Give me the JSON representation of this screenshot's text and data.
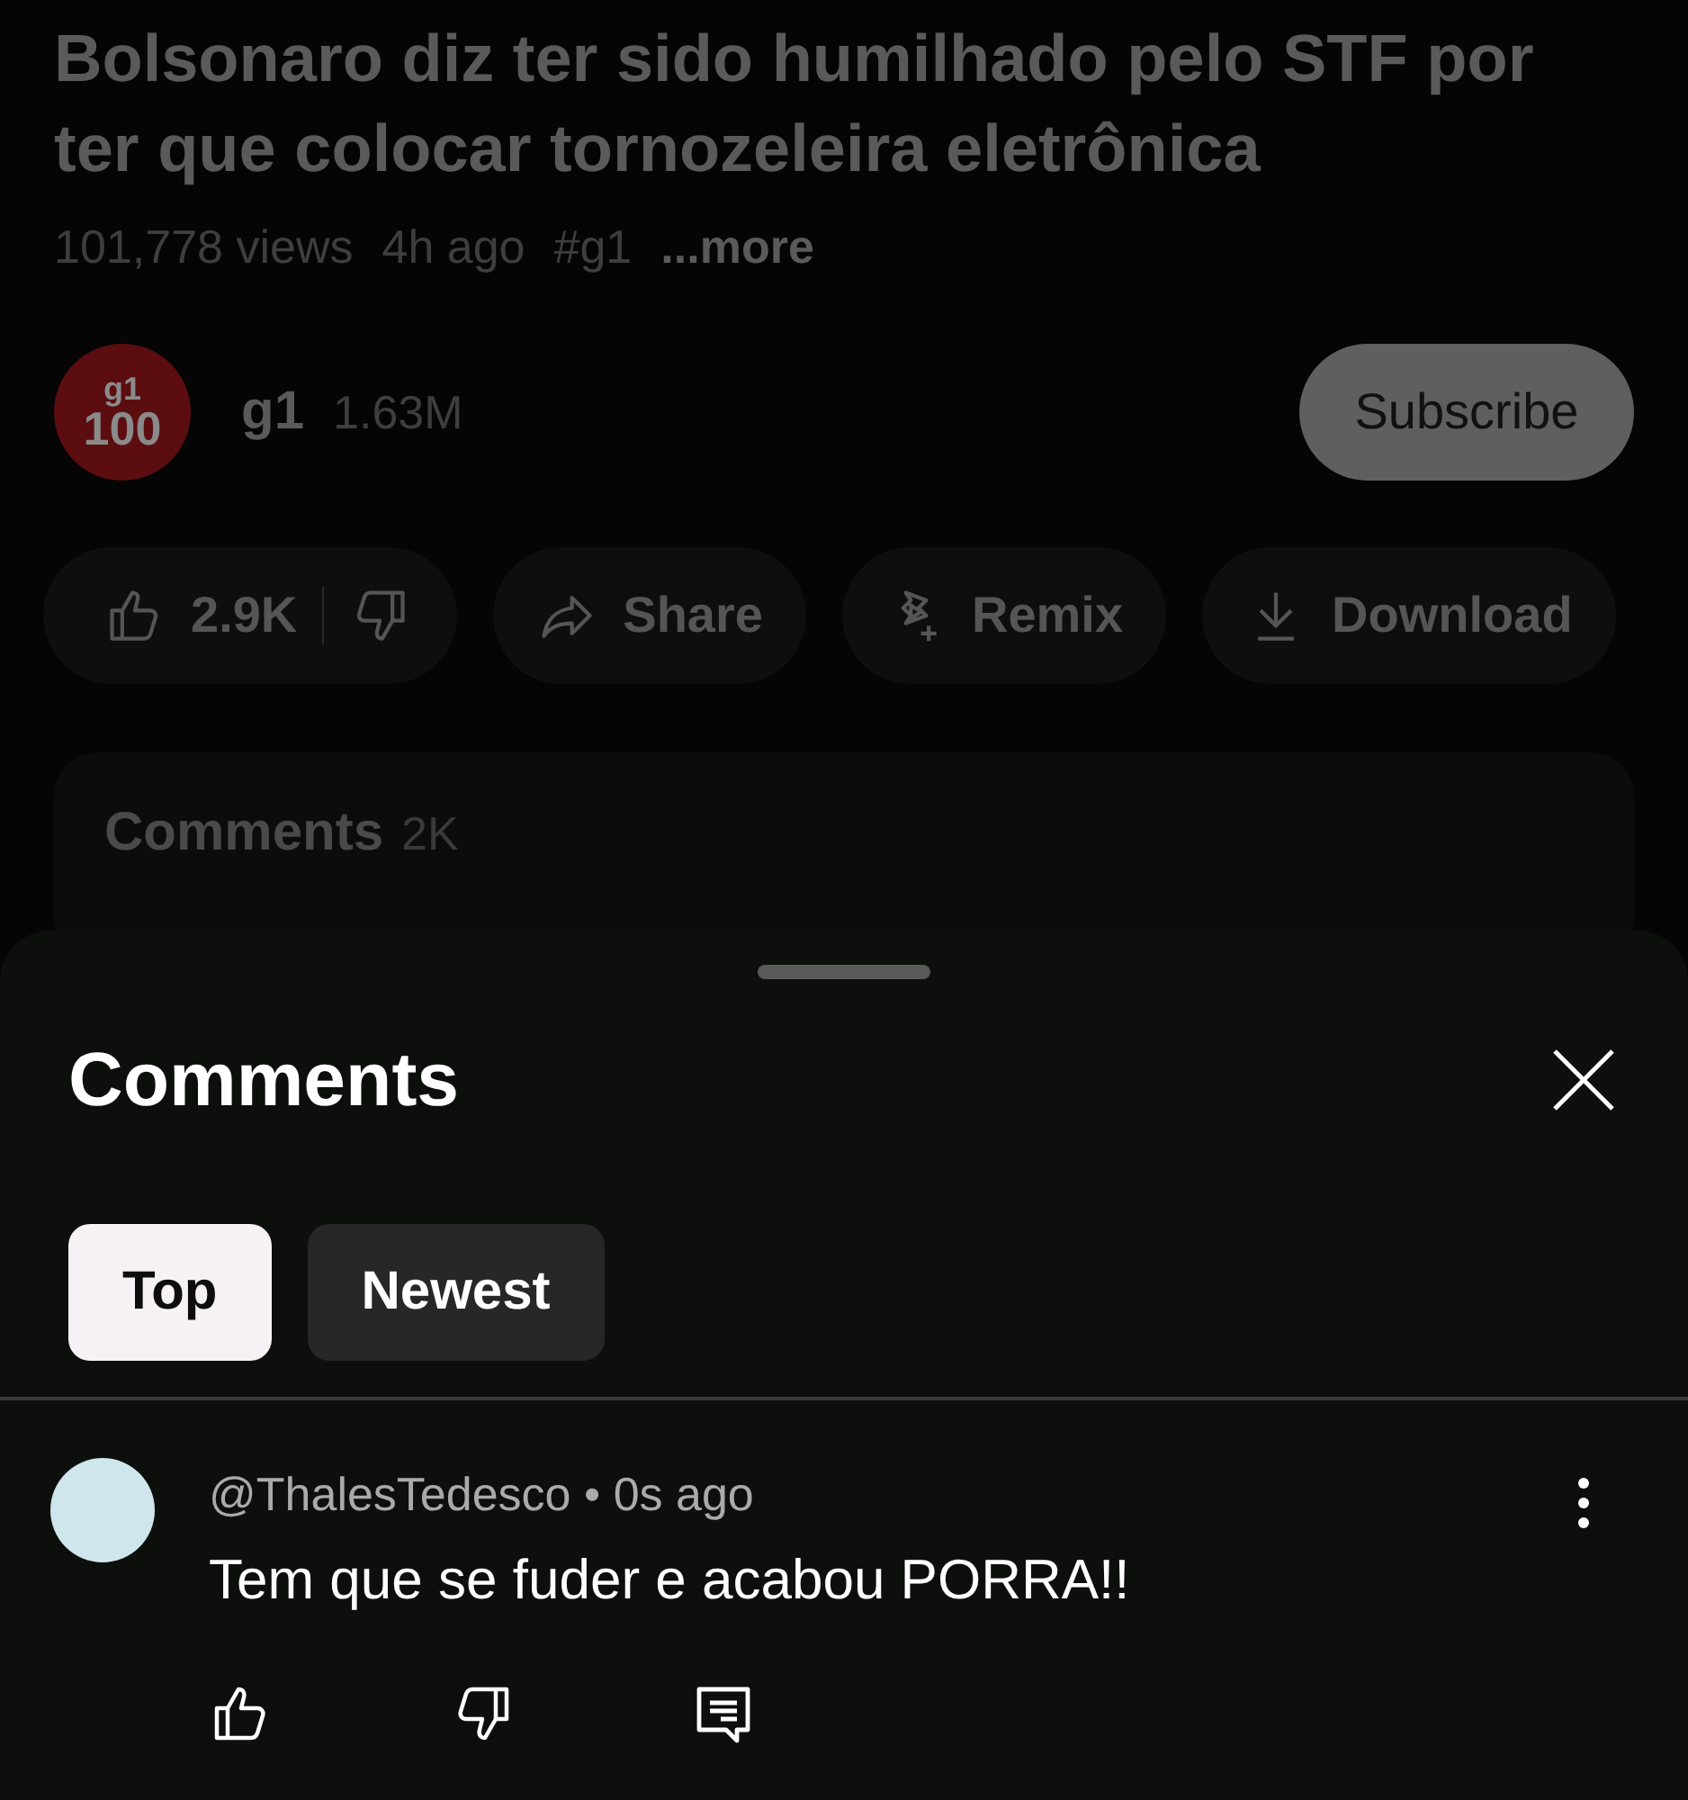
{
  "video": {
    "title": "Bolsonaro diz ter sido humilhado pelo STF por ter que colocar tornozeleira eletrônica",
    "views": "101,778 views",
    "age": "4h ago",
    "hashtag": "#g1",
    "more": "...more"
  },
  "channel": {
    "logo_lines": [
      "g1",
      "100"
    ],
    "name": "g1",
    "subscribers": "1.63M",
    "subscribe": "Subscribe"
  },
  "actions": [
    {
      "kind": "like",
      "label": "2.9K"
    },
    {
      "kind": "share",
      "label": "Share"
    },
    {
      "kind": "remix",
      "label": "Remix"
    },
    {
      "kind": "download",
      "label": "Download"
    }
  ],
  "comments_teaser": {
    "title": "Comments",
    "count": "2K"
  },
  "sheet": {
    "title": "Comments",
    "tabs": [
      {
        "label": "Top",
        "selected": true
      },
      {
        "label": "Newest",
        "selected": false
      }
    ],
    "comments": [
      {
        "author": "@ThalesTedesco",
        "separator": "•",
        "time": "0s ago",
        "text": "Tem que se fuder e acabou PORRA!!"
      }
    ]
  }
}
